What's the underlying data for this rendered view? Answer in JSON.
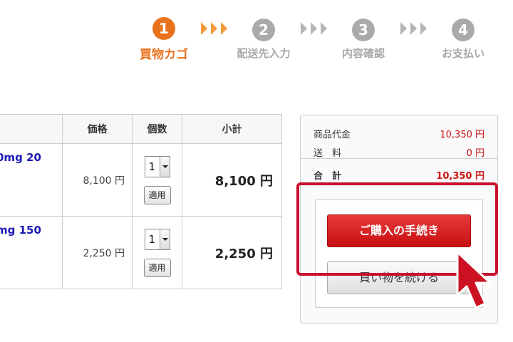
{
  "steps": [
    {
      "number": "1",
      "label": "買物カゴ"
    },
    {
      "number": "2",
      "label": "配送先入力"
    },
    {
      "number": "3",
      "label": "内容確認"
    },
    {
      "number": "4",
      "label": "お支払い"
    }
  ],
  "colors": {
    "active_step": "#e9721c",
    "inactive_step": "#aaaaaa",
    "accent_red": "#cc1111",
    "highlight": "#c8102e"
  },
  "cart": {
    "headers": {
      "name": "",
      "price": "価格",
      "qty": "個数",
      "subtotal": "小計"
    },
    "rows": [
      {
        "name": "0mg 20",
        "price": "8,100 円",
        "qty": "1",
        "apply": "適用",
        "subtotal": "8,100 円"
      },
      {
        "name": "mg 150",
        "price": "2,250 円",
        "qty": "1",
        "apply": "適用",
        "subtotal": "2,250 円"
      }
    ]
  },
  "summary": {
    "items_label": "商品代金",
    "items_value": "10,350 円",
    "shipping_label": "送　料",
    "shipping_value": "0 円",
    "total_label": "合　計",
    "total_value": "10,350 円",
    "purchase_button": "ご購入の手続き",
    "continue_button": "買い物を続ける"
  },
  "icons": {
    "step_arrow": "triple-chevron-right-icon",
    "cursor": "mouse-pointer-icon",
    "select_arrow": "chevron-down-icon"
  }
}
